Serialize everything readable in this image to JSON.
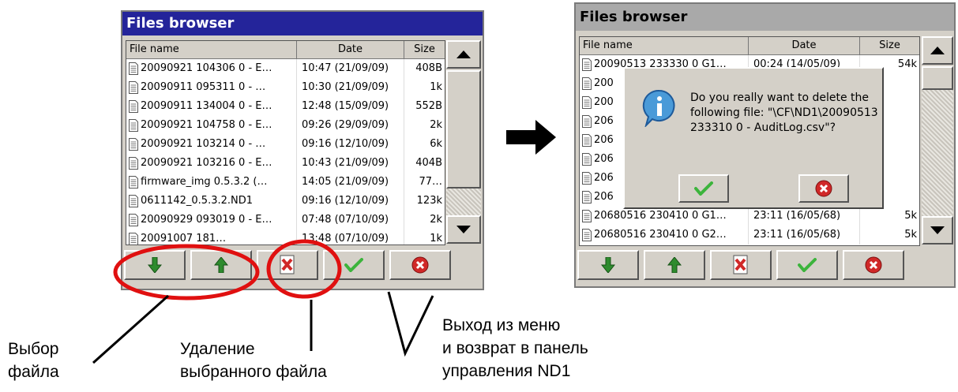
{
  "left_window": {
    "title": "Files browser",
    "columns": [
      "File name",
      "Date",
      "Size"
    ],
    "rows": [
      {
        "name": "20090921 104306 0 - E…",
        "date": "10:47 (21/09/09)",
        "size": "408B"
      },
      {
        "name": "20090911 095311 0 - …",
        "date": "10:30 (21/09/09)",
        "size": "1k"
      },
      {
        "name": "20090911 134004 0 - E…",
        "date": "12:48 (15/09/09)",
        "size": "552B"
      },
      {
        "name": "20090921 104758 0 - E…",
        "date": "09:26 (29/09/09)",
        "size": "2k"
      },
      {
        "name": "20090921 103214 0 - …",
        "date": "09:16 (12/10/09)",
        "size": "6k"
      },
      {
        "name": "20090921 103216 0 - E…",
        "date": "10:43 (21/09/09)",
        "size": "404B"
      },
      {
        "name": "firmware_img 0.5.3.2 (…",
        "date": "14:05 (21/09/09)",
        "size": "77…"
      },
      {
        "name": "0611142_0.5.3.2.ND1",
        "date": "09:16 (12/10/09)",
        "size": "123k"
      },
      {
        "name": "20090929 093019 0 - E…",
        "date": "07:48 (07/10/09)",
        "size": "2k"
      },
      {
        "name": "20091007 181…",
        "date": "13:48 (07/10/09)",
        "size": "1k"
      }
    ]
  },
  "right_window": {
    "title": "Files browser",
    "columns": [
      "File name",
      "Date",
      "Size"
    ],
    "rows": [
      {
        "name": "20090513 233330 0 G1…",
        "date": "00:24 (14/05/09)",
        "size": "54k"
      },
      {
        "name": "200",
        "date": "",
        "size": ""
      },
      {
        "name": "200",
        "date": "",
        "size": ""
      },
      {
        "name": "206",
        "date": "",
        "size": ""
      },
      {
        "name": "206",
        "date": "",
        "size": ""
      },
      {
        "name": "206",
        "date": "",
        "size": ""
      },
      {
        "name": "206",
        "date": "",
        "size": ""
      },
      {
        "name": "206",
        "date": "",
        "size": ""
      },
      {
        "name": "20680516 230410 0 G1…",
        "date": "23:11 (16/05/68)",
        "size": "5k"
      },
      {
        "name": "20680516 230410 0 G2…",
        "date": "23:11 (16/05/68)",
        "size": "5k"
      }
    ],
    "dialog": {
      "message": "Do you really want to delete the following file: \"\\CF\\ND1\\20090513 233310 0 - AuditLog.csv\"?"
    }
  },
  "annotations": {
    "select_file": "Выбор\nфайла",
    "delete_file": "Удаление\nвыбранного файла",
    "exit_menu": "Выход из меню\nи возврат в панель\nуправления ND1"
  },
  "colors": {
    "titlebar_active": "#24249a",
    "titlebar_inactive": "#a9a9a9",
    "down_arrow": "#2e8b2e",
    "ok_check": "#3cb43c",
    "cancel_red": "#d02828",
    "highlight": "#e01010"
  },
  "icons": [
    "file-icon",
    "arrow-down-icon",
    "arrow-up-icon",
    "delete-file-icon",
    "checkmark-icon",
    "cancel-icon",
    "info-icon"
  ]
}
